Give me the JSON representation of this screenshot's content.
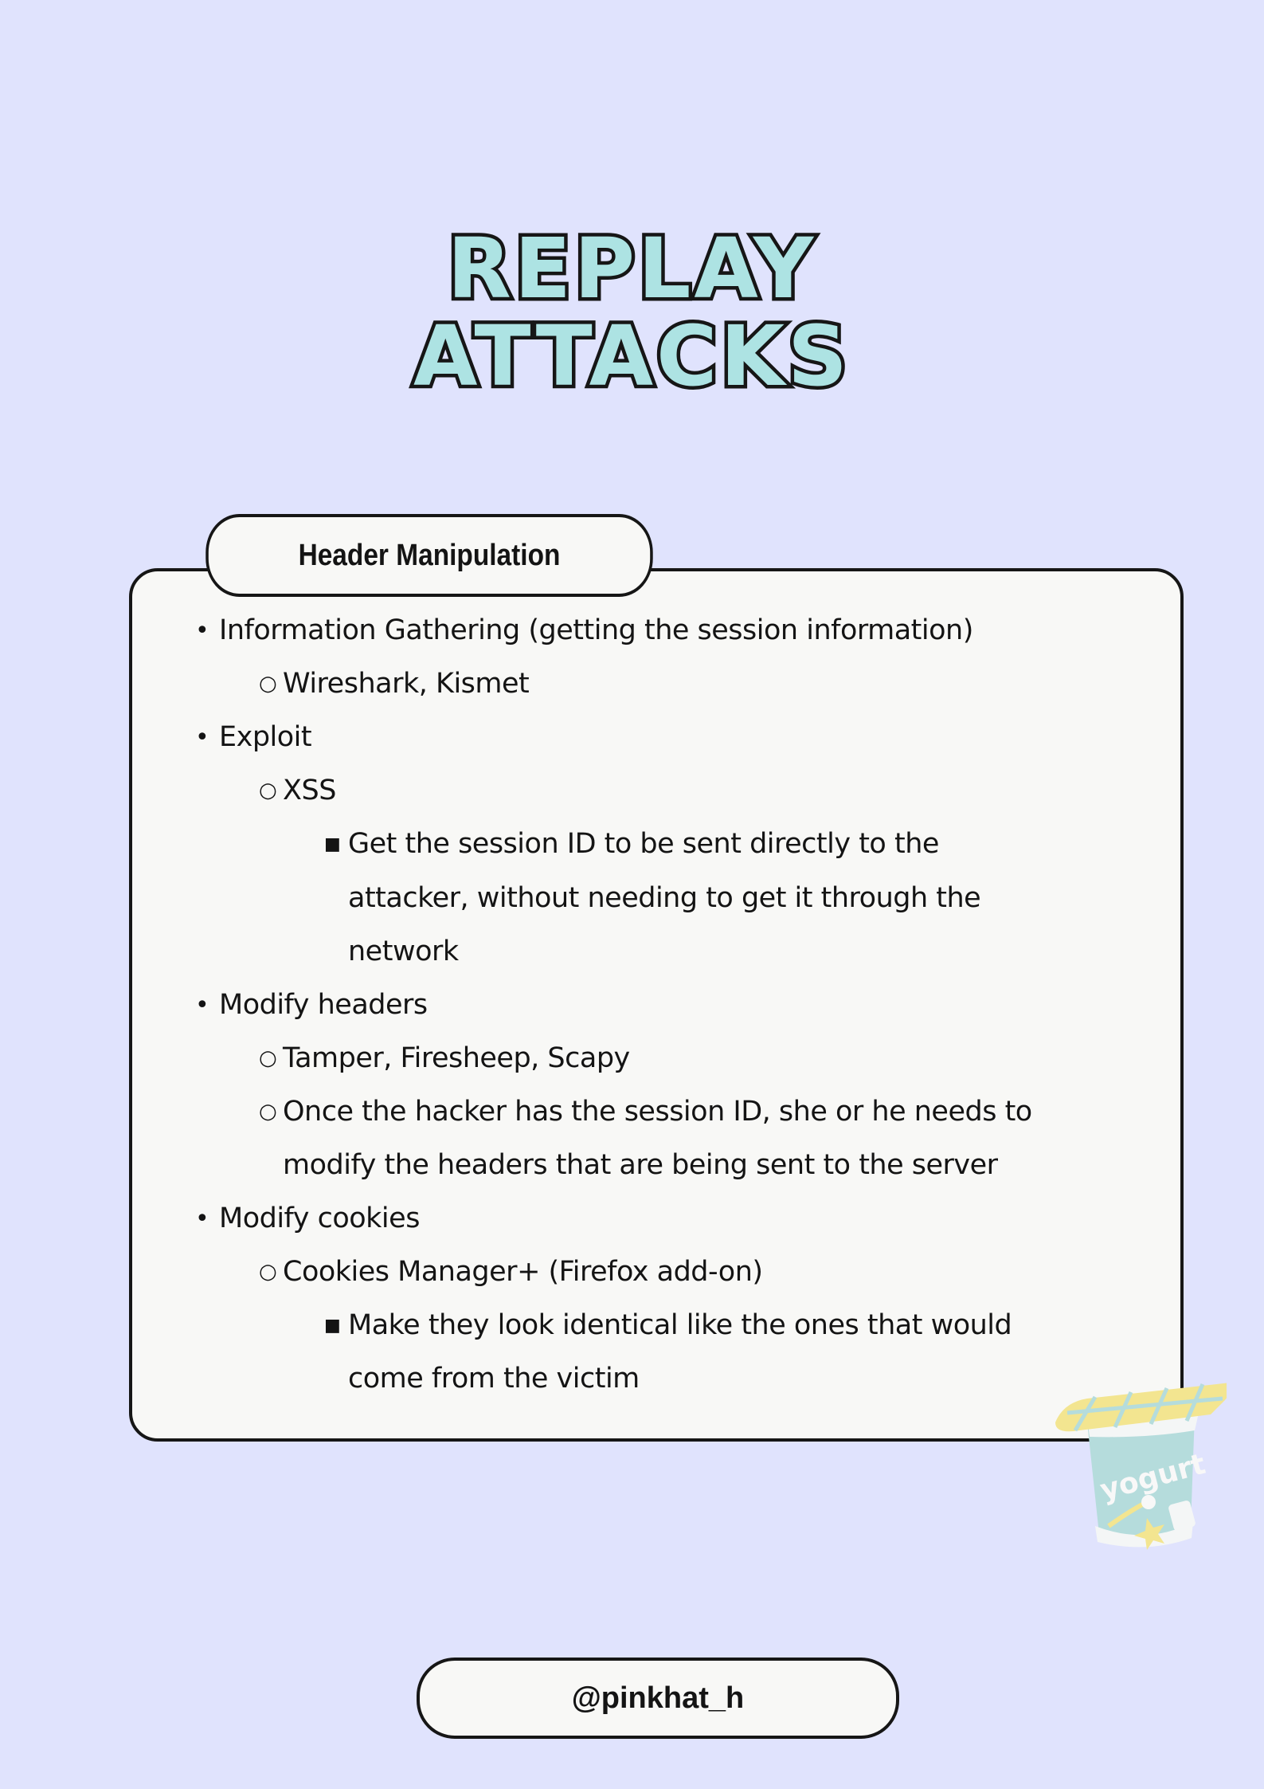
{
  "title": {
    "line1": "REPLAY",
    "line2": "ATTACKS",
    "fill_color": "#ade3e3"
  },
  "section": {
    "tab_label": "Header Manipulation",
    "items": [
      {
        "level": 1,
        "text": "Information Gathering (getting the session information)"
      },
      {
        "level": 2,
        "text": "Wireshark, Kismet"
      },
      {
        "level": 1,
        "text": "Exploit"
      },
      {
        "level": 2,
        "text": "XSS"
      },
      {
        "level": 3,
        "text": "Get the session ID to be sent directly to the"
      },
      {
        "level": 3,
        "text": "attacker, without needing to get it through the",
        "continuation": true
      },
      {
        "level": 3,
        "text": "network",
        "continuation": true
      },
      {
        "level": 1,
        "text": "Modify headers"
      },
      {
        "level": 2,
        "text": "Tamper, Firesheep, Scapy"
      },
      {
        "level": 2,
        "text": "Once the hacker has the session ID, she or he needs to"
      },
      {
        "level": 2,
        "text": "modify the headers that are being sent to the server",
        "continuation": true
      },
      {
        "level": 1,
        "text": "Modify cookies"
      },
      {
        "level": 2,
        "text": "Cookies Manager+ (Firefox add-on)"
      },
      {
        "level": 3,
        "text": "Make they look identical like the ones that would"
      },
      {
        "level": 3,
        "text": "come from the victim",
        "continuation": true
      }
    ]
  },
  "decoration": {
    "sticker_text": "yogurt"
  },
  "footer": {
    "handle": "@pinkhat_h"
  }
}
